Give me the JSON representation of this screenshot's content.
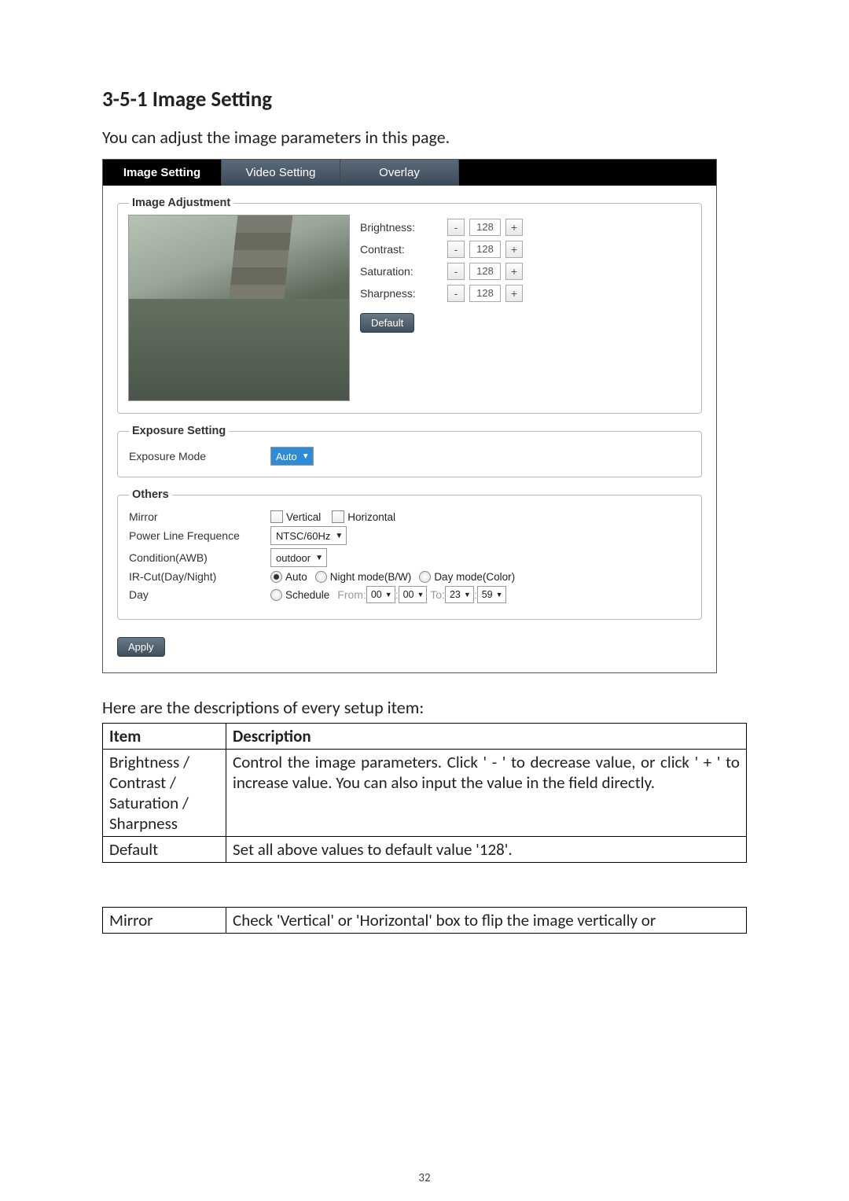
{
  "heading": "3-5-1 Image Setting",
  "intro": "You can adjust the image parameters in this page.",
  "tabs": {
    "image": "Image Setting",
    "video": "Video Setting",
    "overlay": "Overlay"
  },
  "groups": {
    "image_adjust": "Image Adjustment",
    "exposure": "Exposure Setting",
    "others": "Others"
  },
  "sliders": {
    "brightness": {
      "label": "Brightness:",
      "value": "128",
      "minus": "-",
      "plus": "+"
    },
    "contrast": {
      "label": "Contrast:",
      "value": "128",
      "minus": "-",
      "plus": "+"
    },
    "saturation": {
      "label": "Saturation:",
      "value": "128",
      "minus": "-",
      "plus": "+"
    },
    "sharpness": {
      "label": "Sharpness:",
      "value": "128",
      "minus": "-",
      "plus": "+"
    }
  },
  "buttons": {
    "default": "Default",
    "apply": "Apply"
  },
  "exposure": {
    "mode_label": "Exposure Mode",
    "mode_value": "Auto"
  },
  "others": {
    "mirror_label": "Mirror",
    "mirror_vertical": "Vertical",
    "mirror_horizontal": "Horizontal",
    "freq_label": "Power Line Frequence",
    "freq_value": "NTSC/60Hz",
    "awb_label": "Condition(AWB)",
    "awb_value": "outdoor",
    "ircut_label": "IR-Cut(Day/Night)",
    "ircut_auto": "Auto",
    "ircut_night": "Night mode(B/W)",
    "ircut_day": "Day mode(Color)",
    "day_label": "Day",
    "schedule_label": "Schedule",
    "from_label": "From:",
    "to_label": "To:",
    "from_h": "00",
    "from_m": "00",
    "to_h": "23",
    "to_m": "59",
    "colon": ":"
  },
  "desc_intro": "Here are the descriptions of every setup item:",
  "desc_header": {
    "item": "Item",
    "desc": "Description"
  },
  "desc_rows": {
    "r1": {
      "item": "Brightness / Contrast / Saturation / Sharpness",
      "desc": "Control the image parameters. Click ' - ' to decrease value, or click ' + ' to increase value. You can also input the value in the field directly."
    },
    "r2": {
      "item": "Default",
      "desc": "Set all above values to default value '128'."
    },
    "r3": {
      "item": "Mirror",
      "desc": "Check 'Vertical' or 'Horizontal' box to flip the image vertically or"
    }
  },
  "page_number": "32"
}
